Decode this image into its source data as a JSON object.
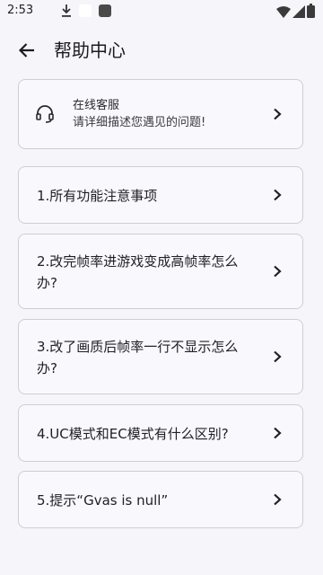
{
  "status_bar": {
    "time": "2:53"
  },
  "header": {
    "title": "帮助中心"
  },
  "service": {
    "title": "在线客服",
    "description": "请详细描述您遇见的问题!"
  },
  "faq": [
    {
      "label": "1.所有功能注意事项"
    },
    {
      "label": "2.改完帧率进游戏变成高帧率怎么办?"
    },
    {
      "label": "3.改了画质后帧率一行不显示怎么办?"
    },
    {
      "label": "4.UC模式和EC模式有什么区别?"
    },
    {
      "label": "5.提示“Gvas is null”"
    }
  ]
}
